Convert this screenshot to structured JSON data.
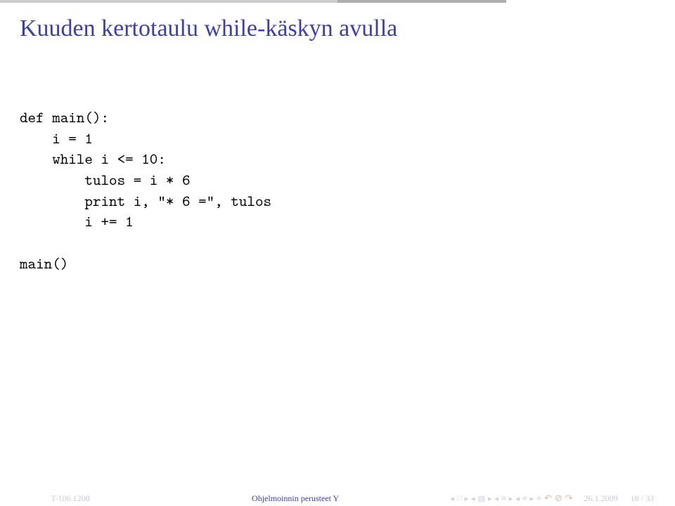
{
  "title": "Kuuden kertotaulu while-käskyn avulla",
  "code": "def main():\n    i = 1\n    while i <= 10:\n        tulos = i * 6\n        print i, \"* 6 =\", tulos\n        i += 1\n\nmain()",
  "footer": {
    "left": "T-106.1208",
    "center": "Ohjelmoinnin perusteet Y",
    "date": "26.1.2009",
    "page": "18 / 33"
  }
}
